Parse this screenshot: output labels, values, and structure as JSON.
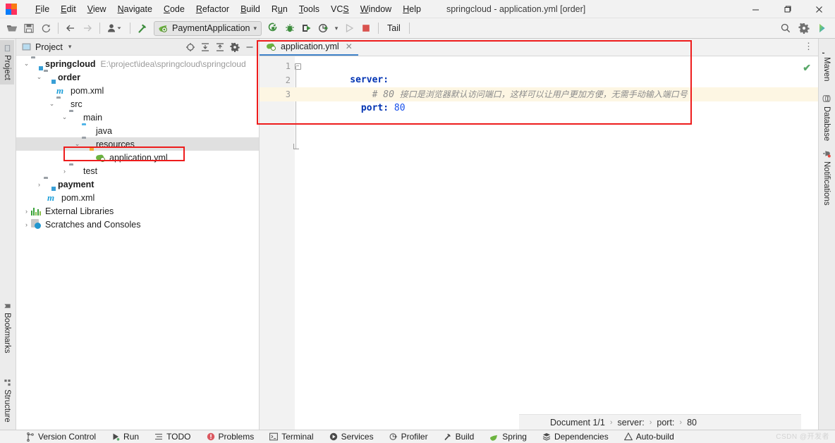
{
  "window": {
    "title": "springcloud - application.yml [order]",
    "logo_letter": "IJ",
    "minimize": "—",
    "maximize": "❐",
    "close": "✕"
  },
  "menubar": [
    {
      "label": "File",
      "mnemonic": "F"
    },
    {
      "label": "Edit",
      "mnemonic": "E"
    },
    {
      "label": "View",
      "mnemonic": "V"
    },
    {
      "label": "Navigate",
      "mnemonic": "N"
    },
    {
      "label": "Code",
      "mnemonic": "C"
    },
    {
      "label": "Refactor",
      "mnemonic": "R"
    },
    {
      "label": "Build",
      "mnemonic": "B"
    },
    {
      "label": "Run",
      "mnemonic": "u"
    },
    {
      "label": "Tools",
      "mnemonic": "T"
    },
    {
      "label": "VCS",
      "mnemonic": "S"
    },
    {
      "label": "Window",
      "mnemonic": "W"
    },
    {
      "label": "Help",
      "mnemonic": "H"
    }
  ],
  "toolbar": {
    "open_icon": "open-folder-icon",
    "save_icon": "save-icon",
    "sync_icon": "refresh-icon",
    "back_icon": "back-arrow-icon",
    "forward_icon": "forward-arrow-icon",
    "profile_icon": "user-profile-icon",
    "build_icon": "build-hammer-icon",
    "run_config": "PaymentApplication",
    "rerun_icon": "rerun-icon",
    "debug_icon": "debug-bug-icon",
    "coverage_icon": "run-with-coverage-icon",
    "profiler_icon": "profiler-icon",
    "run_icon": "run-play-icon",
    "stop_icon": "stop-square-icon",
    "tail_label": "Tail",
    "search_icon": "search-icon",
    "settings_icon": "gear-icon",
    "updates_icon": "updates-icon"
  },
  "left_stripe": {
    "project": "Project",
    "bookmarks": "Bookmarks",
    "structure": "Structure"
  },
  "project_panel": {
    "title": "Project",
    "dropdown_caret": "▾",
    "actions": [
      {
        "name": "select-opened-file-icon"
      },
      {
        "name": "expand-all-icon"
      },
      {
        "name": "collapse-all-icon"
      },
      {
        "name": "gear-icon"
      },
      {
        "name": "hide-icon"
      }
    ],
    "tree": [
      {
        "indent": 0,
        "twisty": "⌄",
        "icon": "module-folder-icon",
        "label": "springcloud",
        "bold": true,
        "path": "E:\\project\\idea\\springcloud\\springcloud",
        "selected": false
      },
      {
        "indent": 1,
        "twisty": "⌄",
        "icon": "module-folder-icon",
        "label": "order",
        "bold": true,
        "path": "",
        "selected": false
      },
      {
        "indent": 2,
        "twisty": "",
        "icon": "maven-pom-icon",
        "label": "pom.xml",
        "bold": false,
        "path": "",
        "selected": false
      },
      {
        "indent": 2,
        "twisty": "⌄",
        "icon": "folder-icon",
        "label": "src",
        "bold": false,
        "path": "",
        "selected": false
      },
      {
        "indent": 3,
        "twisty": "⌄",
        "icon": "folder-icon",
        "label": "main",
        "bold": false,
        "path": "",
        "selected": false
      },
      {
        "indent": 4,
        "twisty": "",
        "icon": "source-folder-icon",
        "label": "java",
        "bold": false,
        "path": "",
        "selected": false
      },
      {
        "indent": 4,
        "twisty": "⌄",
        "icon": "resources-folder-icon",
        "label": "resources",
        "bold": false,
        "path": "",
        "selected": true
      },
      {
        "indent": 5,
        "twisty": "",
        "icon": "yaml-spring-file-icon",
        "label": "application.yml",
        "bold": false,
        "path": "",
        "selected": false
      },
      {
        "indent": 3,
        "twisty": "›",
        "icon": "folder-icon",
        "label": "test",
        "bold": false,
        "path": "",
        "selected": false
      },
      {
        "indent": 1,
        "twisty": "›",
        "icon": "module-folder-icon",
        "label": "payment",
        "bold": true,
        "path": "",
        "selected": false
      },
      {
        "indent": 2,
        "twisty": "",
        "icon": "maven-pom-icon",
        "label": "pom.xml",
        "bold": false,
        "path": "",
        "selected": false
      },
      {
        "indent": 0,
        "twisty": "›",
        "icon": "external-libraries-icon",
        "label": "External Libraries",
        "bold": false,
        "path": "",
        "selected": false
      },
      {
        "indent": 0,
        "twisty": "›",
        "icon": "scratches-icon",
        "label": "Scratches and Consoles",
        "bold": false,
        "path": "",
        "selected": false
      }
    ]
  },
  "editor": {
    "tab": {
      "label": "application.yml",
      "icon": "yaml-spring-file-icon",
      "close": "✕"
    },
    "more_icon": "⋮",
    "inspection_status": "✔",
    "lines": [
      {
        "no": "1",
        "indent": 0,
        "current": false,
        "fold": "minus",
        "segments": [
          {
            "type": "key",
            "text": "server:"
          }
        ]
      },
      {
        "no": "2",
        "indent": 0,
        "current": false,
        "fold": "",
        "segments": [
          {
            "type": "comment",
            "text": "    # 80 "
          },
          {
            "type": "comment-cjk",
            "text": "接口是浏览器默认访问端口，这样可以让用户更加方便，无需手动输入端口号"
          }
        ]
      },
      {
        "no": "3",
        "indent": 0,
        "current": true,
        "fold": "end",
        "segments": [
          {
            "type": "key",
            "text": "  port: "
          },
          {
            "type": "number",
            "text": "80"
          }
        ]
      }
    ]
  },
  "breadcrumb": {
    "items": [
      "Document 1/1",
      "server:",
      "port:",
      "80"
    ],
    "separator": "›"
  },
  "right_stripe": [
    {
      "label": "Maven",
      "icon": "maven-icon"
    },
    {
      "label": "Database",
      "icon": "database-icon"
    },
    {
      "label": "Notifications",
      "icon": "notifications-bell-icon"
    }
  ],
  "statusbar": {
    "items": [
      {
        "label": "Version Control",
        "icon": "branch-icon"
      },
      {
        "label": "Run",
        "icon": "run-play-icon"
      },
      {
        "label": "TODO",
        "icon": "todo-list-icon"
      },
      {
        "label": "Problems",
        "icon": "problems-error-icon"
      },
      {
        "label": "Terminal",
        "icon": "terminal-icon"
      },
      {
        "label": "Services",
        "icon": "services-icon"
      },
      {
        "label": "Profiler",
        "icon": "profiler-icon"
      },
      {
        "label": "Build",
        "icon": "build-hammer-icon"
      },
      {
        "label": "Spring",
        "icon": "spring-leaf-icon"
      },
      {
        "label": "Dependencies",
        "icon": "dependencies-icon"
      },
      {
        "label": "Auto-build",
        "icon": "warning-triangle-icon"
      }
    ],
    "watermark": "CSDN @开发者"
  },
  "annotations": {
    "accent_red": "#ee1c1c",
    "tab_underline": "#4083c9",
    "current_line": "#fdf6e3"
  }
}
